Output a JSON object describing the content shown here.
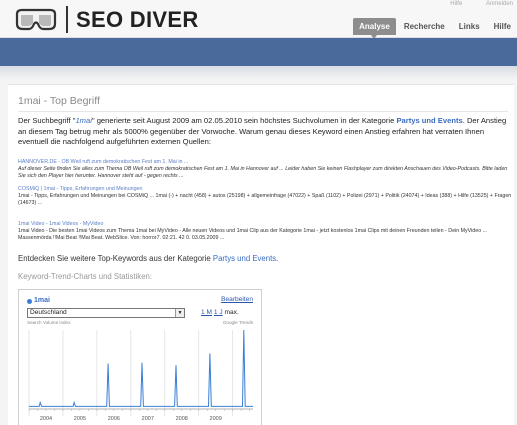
{
  "header": {
    "logo_text": "SEO DIVER",
    "top_links": [
      "Hilfe",
      "Anmelden"
    ],
    "nav": [
      {
        "label": "Analyse",
        "active": true
      },
      {
        "label": "Recherche",
        "active": false
      },
      {
        "label": "Links",
        "active": false
      },
      {
        "label": "Hilfe",
        "active": false
      }
    ]
  },
  "colors": {
    "accent_bar": "#4a6a9c",
    "link": "#3a6cc0",
    "series": "#3a7fd6"
  },
  "page": {
    "title": "1mai - Top Begriff",
    "intro": {
      "p1": "Der Suchbegriff \"",
      "keyword": "1mai",
      "p2": "\" generierte seit August 2009 am 02.05.2010 sein höchstes Suchvolumen in der Kategorie ",
      "category": "Partys und Events",
      "p3": ". Der Anstieg an diesem Tag betrug mehr als 5000% gegenüber der Vorwoche. Warum genau dieses Keyword einen Anstieg erfahren hat verraten Ihnen eventuell die nachfolgend aufgeführten externen Quellen:"
    },
    "results": [
      {
        "title": "HANNOVER.DE - OB Weil ruft zum demokratischen Fest am 1. Mai in ...",
        "text": "Auf dieser Seite finden Sie alles zum Thema OB Weil ruft zum demokratischen Fest am 1. Mai in Hannover auf ... Leider haben Sie keinen Flashplayer zum direkten Anschauen des Video-Podcasts. Bitte laden Sie sich den Player hier herunter. Hannover steht auf - gegen rechts ..."
      },
      {
        "title": "COSMiQ | 1mai - Tipps, Erfahrungen und Meinungen",
        "text": "1mai - Tipps, Erfahrungen und Meinungen bei COSMiQ ... 1mai (-) + nacht (458) + autos (25198) + allgemeinfrage (47022) + Spaß (1102) + Polizei (2971) + Politik (24074) + Ideas (388) + Hilfe (13525) + Fragen (14673) ..."
      },
      {
        "title": "1mai Video - 1mai Videos - MyVideo",
        "text": "1mai Video - Die besten 1mai Videos zum Thema 1mai bei MyVideo - Alle neuen Videos und 1mai Clip aus der Kategorie 1mai - jetzt kostenlos 1mai Clips mit deinen Freunden teilen - Dein MyVideo ... Massenmörda !!Mai Beat !!Mai Beat. WebSlice. Von: horror7. 02:21. 42 0. 03.05.2009 ..."
      }
    ],
    "discover": {
      "text": "Entdecken Sie weitere Top-Keywords aus der Kategorie ",
      "category": "Partys und Events",
      "suffix": "."
    },
    "charts_heading": "Keyword-Trend-Charts und Statistiken:",
    "chart_widget": {
      "legend_label": "1mai",
      "edit_label": "Bearbeiten",
      "region_value": "Deutschland",
      "range_links": [
        "1 M",
        "1 J"
      ],
      "range_suffix": "max.",
      "left_note": "Search Volume index",
      "right_note": "Google Trends"
    }
  },
  "chart_data": {
    "type": "line",
    "title": "",
    "xlabel": "",
    "ylabel": "Search Volume index",
    "x_ticks": [
      "2004",
      "2005",
      "2006",
      "2007",
      "2008",
      "2009"
    ],
    "x_range": [
      2004.0,
      2010.6
    ],
    "y_range": [
      0,
      100
    ],
    "grid": false,
    "series": [
      {
        "name": "1mai",
        "points": [
          [
            2004.0,
            2
          ],
          [
            2004.3,
            2
          ],
          [
            2004.33,
            7
          ],
          [
            2004.37,
            2
          ],
          [
            2005.3,
            2
          ],
          [
            2005.33,
            7
          ],
          [
            2005.37,
            2
          ],
          [
            2006.29,
            2
          ],
          [
            2006.33,
            57
          ],
          [
            2006.37,
            2
          ],
          [
            2007.29,
            2
          ],
          [
            2007.33,
            58
          ],
          [
            2007.37,
            2
          ],
          [
            2008.29,
            2
          ],
          [
            2008.33,
            55
          ],
          [
            2008.37,
            2
          ],
          [
            2009.29,
            2
          ],
          [
            2009.33,
            70
          ],
          [
            2009.37,
            2
          ],
          [
            2010.29,
            2
          ],
          [
            2010.33,
            100
          ],
          [
            2010.37,
            2
          ],
          [
            2010.6,
            2
          ]
        ]
      }
    ]
  }
}
